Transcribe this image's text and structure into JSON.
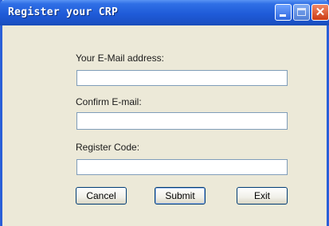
{
  "window": {
    "title": "Register your CRP",
    "controls": {
      "minimize_icon": "minimize-icon",
      "maximize_icon": "maximize-icon",
      "close_icon": "close-icon",
      "close_glyph": "✕"
    }
  },
  "form": {
    "email_label": "Your E-Mail address:",
    "email_value": "",
    "confirm_label": "Confirm E-mail:",
    "confirm_value": "",
    "code_label": "Register Code:",
    "code_value": ""
  },
  "buttons": {
    "cancel": "Cancel",
    "submit": "Submit",
    "exit": "Exit"
  },
  "colors": {
    "titlebar": "#1f5bd8",
    "window_bg": "#ece9d8",
    "close_button": "#cc3b14"
  }
}
